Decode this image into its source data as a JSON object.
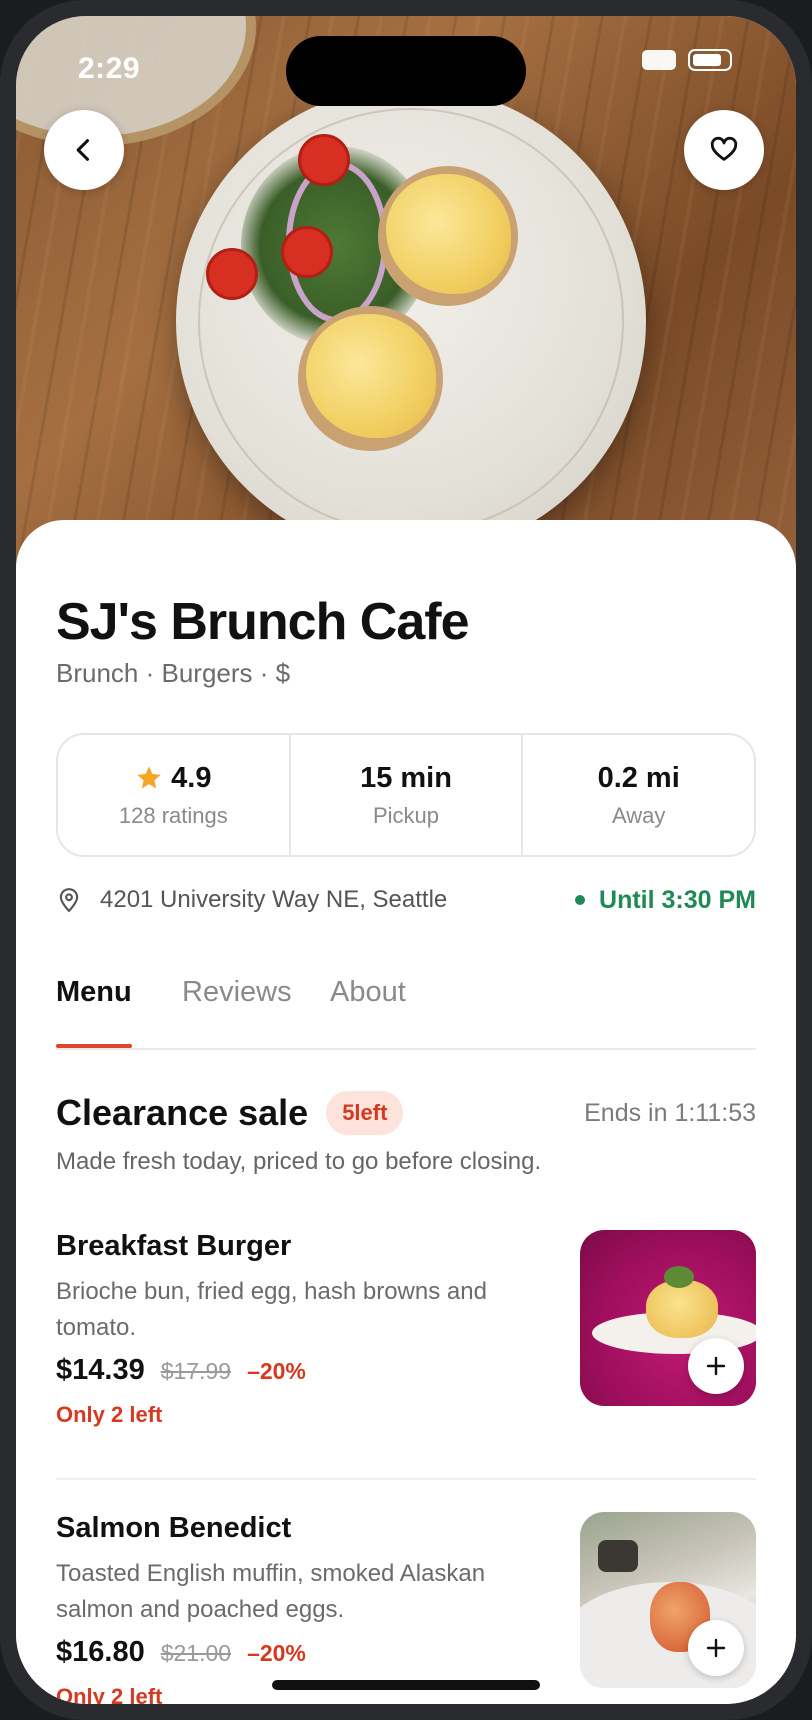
{
  "status_bar": {
    "time": "2:29"
  },
  "hero": {
    "back_icon": "chevron-left-icon",
    "favorite_icon": "heart-outline-icon"
  },
  "restaurant": {
    "name": "SJ's Brunch Cafe",
    "categories": "Brunch · Burgers · $",
    "stats": [
      {
        "value": "4.9",
        "label": "128 ratings",
        "icon": "star-icon",
        "icon_color": "#f5a623"
      },
      {
        "value": "15 min",
        "label": "Pickup"
      },
      {
        "value": "0.2 mi",
        "label": "Away"
      }
    ],
    "address": "4201 University Way NE, Seattle",
    "address_icon": "map-pin-icon",
    "hours_status": "Until 3:30 PM",
    "open_color": "#1f8a55"
  },
  "tabs": [
    {
      "label": "Menu",
      "active": true
    },
    {
      "label": "Reviews",
      "active": false
    },
    {
      "label": "About",
      "active": false
    }
  ],
  "section": {
    "title": "Clearance sale",
    "badge": "5left",
    "ends": "Ends in 1:11:53",
    "description": "Made fresh today, priced to go before closing."
  },
  "items": [
    {
      "name": "Breakfast Burger",
      "description": "Brioche bun, fried egg, hash browns and tomato.",
      "price": "$14.39",
      "old_price": "$17.99",
      "discount": "–20%",
      "stock_note": "Only 2 left",
      "add_icon": "plus-icon"
    },
    {
      "name": "Salmon Benedict",
      "description": "Toasted English muffin, smoked Alaskan salmon and poached eggs.",
      "price": "$16.80",
      "old_price": "$21.00",
      "discount": "–20%",
      "stock_note": "Only 2 left",
      "add_icon": "plus-icon"
    }
  ],
  "colors": {
    "accent": "#e0452b",
    "sale": "#d5391f",
    "text": "#111111"
  }
}
